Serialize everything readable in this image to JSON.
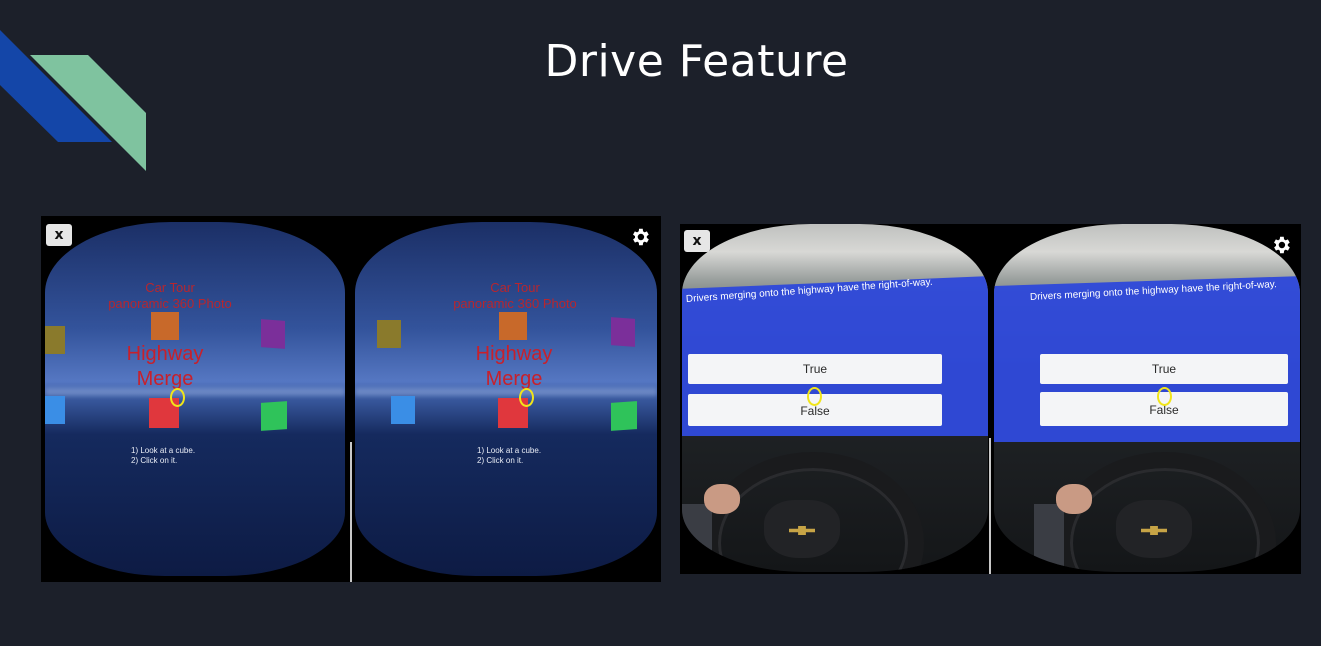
{
  "slide": {
    "title": "Drive Feature",
    "accent_colors": {
      "dark_blue": "#1446a8",
      "mint": "#7fc39f",
      "background": "#1c202a"
    }
  },
  "left_screenshot": {
    "close_label": "x",
    "settings_icon": "gear-icon",
    "lens_left": {
      "menu_title_line1": "Car Tour",
      "menu_title_line2": "panoramic 360 Photo",
      "highlight_line1": "Highway",
      "highlight_line2": "Merge",
      "instruction_1": "1) Look at a cube.",
      "instruction_2": "2) Click on it."
    },
    "lens_right": {
      "menu_title_line1": "Car Tour",
      "menu_title_line2": "panoramic 360 Photo",
      "highlight_line1": "Highway",
      "highlight_line2": "Merge",
      "instruction_1": "1) Look at a cube.",
      "instruction_2": "2) Click on it."
    },
    "cube_colors": {
      "olive": "#8a7a2c",
      "orange": "#c8692a",
      "purple": "#7b2f9a",
      "blue": "#3a8ee6",
      "red": "#e0373d",
      "green": "#2fc35a"
    }
  },
  "right_screenshot": {
    "close_label": "x",
    "settings_icon": "gear-icon",
    "lens_left": {
      "question": "Drivers merging onto the highway have the right-of-way.",
      "true_label": "True",
      "false_label": "False"
    },
    "lens_right": {
      "question": "Drivers merging onto the highway have the right-of-way.",
      "true_label": "True",
      "false_label": "False"
    },
    "panel_color": "#2f49d9"
  }
}
